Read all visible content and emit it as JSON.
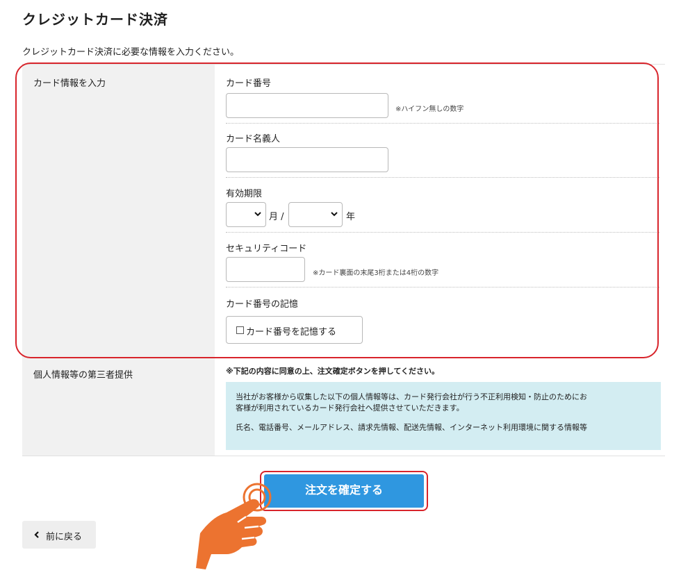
{
  "page": {
    "title": "クレジットカード決済",
    "description": "クレジットカード決済に必要な情報を入力ください。"
  },
  "card_section": {
    "label": "カード情報を入力",
    "card_number": {
      "label": "カード番号",
      "value": "",
      "hint": "※ハイフン無しの数字"
    },
    "card_holder": {
      "label": "カード名義人",
      "value": ""
    },
    "expiry": {
      "label": "有効期限",
      "month_value": "",
      "month_unit": "月 /",
      "year_value": "",
      "year_unit": "年"
    },
    "security_code": {
      "label": "セキュリティコード",
      "value": "",
      "hint": "※カード裏面の末尾3桁または4桁の数字"
    },
    "remember": {
      "label": "カード番号の記憶",
      "checkbox_label": "カード番号を記憶する",
      "checked": false
    }
  },
  "privacy_section": {
    "label": "個人情報等の第三者提供",
    "notice": "※下記の内容に同意の上、注文確定ボタンを押してください。",
    "body_1": "当社がお客様から収集した以下の個人情報等は、カード発行会社が行う不正利用検知・防止のためにお",
    "body_2": "客様が利用されているカード発行会社へ提供させていただきます。",
    "items": "氏名、電話番号、メールアドレス、請求先情報、配送先情報、インターネット利用環境に関する情報等"
  },
  "actions": {
    "confirm_label": "注文を確定する",
    "back_label": "前に戻る"
  },
  "colors": {
    "accent_blue": "#2f97e0",
    "highlight_red": "#d8242b",
    "info_bg": "#d3edf2",
    "hand_orange": "#ec7330"
  },
  "icons": {
    "dropdown": "chevron-down-icon",
    "back": "chevron-left-icon",
    "pointer": "pointing-hand-icon"
  }
}
